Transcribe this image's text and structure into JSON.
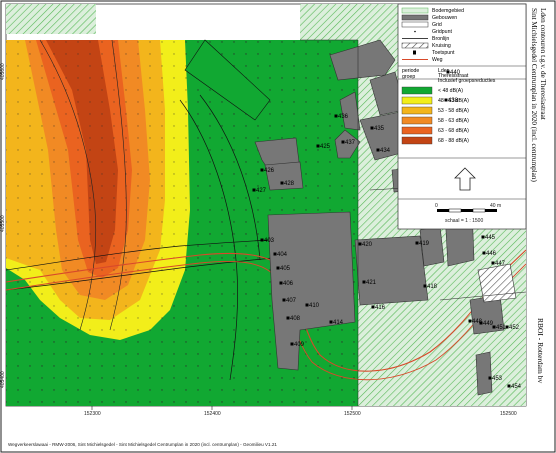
{
  "title": {
    "line1": "Sint Michielsgedel Centrumplan in 2020 (incl. centrumplan)",
    "line2": "Lden contouren t.g.v. de Theresiastraat"
  },
  "legend_items": [
    {
      "label": "Bodemgebied"
    },
    {
      "label": "Gebouwen"
    },
    {
      "label": "Grid"
    },
    {
      "label": "Gridpunt"
    },
    {
      "label": "Bronlijn"
    },
    {
      "label": "Kruising"
    },
    {
      "label": "Toetspunt"
    },
    {
      "label": "Weg"
    }
  ],
  "periode_header": {
    "col1": "periode",
    "col2": "Lden",
    "col1b": "groep",
    "col2b": "Theresistraat",
    "col2c": "Inclusief groepsreducties"
  },
  "noise_classes": [
    {
      "label": "< 48 dB(A)",
      "color": "#11a832"
    },
    {
      "label": "48 - 53 dB(A)",
      "color": "#f2ee1a"
    },
    {
      "label": "53 - 58 dB(A)",
      "color": "#f3b51c"
    },
    {
      "label": "58 - 63 dB(A)",
      "color": "#f18a24"
    },
    {
      "label": "63 - 68 dB(A)",
      "color": "#ea6320"
    },
    {
      "label": "68 - 88 dB(A)",
      "color": "#c34414"
    }
  ],
  "scale": {
    "ticks": [
      "0",
      "40 m"
    ],
    "label": "schaal = 1 : 1500"
  },
  "axes": {
    "x_ticks": [
      "152300",
      "152400",
      "152500"
    ],
    "y_ticks": [
      "405600",
      "405500",
      "405400"
    ]
  },
  "footer_left": "Wegverkeerslawaai - RMW-2006, Sint Michielsgedel - Sint Michielsgedel Centrumplan in 2020 (incl. centrumplan) - Geomilieu V1.21",
  "footer_right": "RBOI - Rotterdam bv",
  "points": [
    {
      "label": "440"
    },
    {
      "label": "438"
    },
    {
      "label": "437"
    },
    {
      "label": "436"
    },
    {
      "label": "435"
    },
    {
      "label": "434"
    },
    {
      "label": "426"
    },
    {
      "label": "425"
    },
    {
      "label": "427"
    },
    {
      "label": "428"
    },
    {
      "label": "403"
    },
    {
      "label": "404"
    },
    {
      "label": "405"
    },
    {
      "label": "406"
    },
    {
      "label": "407"
    },
    {
      "label": "408"
    },
    {
      "label": "409"
    },
    {
      "label": "420"
    },
    {
      "label": "419"
    },
    {
      "label": "421"
    },
    {
      "label": "418"
    },
    {
      "label": "416"
    },
    {
      "label": "445"
    },
    {
      "label": "446"
    },
    {
      "label": "447"
    },
    {
      "label": "448"
    },
    {
      "label": "449"
    },
    {
      "label": "451"
    },
    {
      "label": "452"
    },
    {
      "label": "453"
    },
    {
      "label": "454"
    },
    {
      "label": "410"
    },
    {
      "label": "414"
    }
  ]
}
